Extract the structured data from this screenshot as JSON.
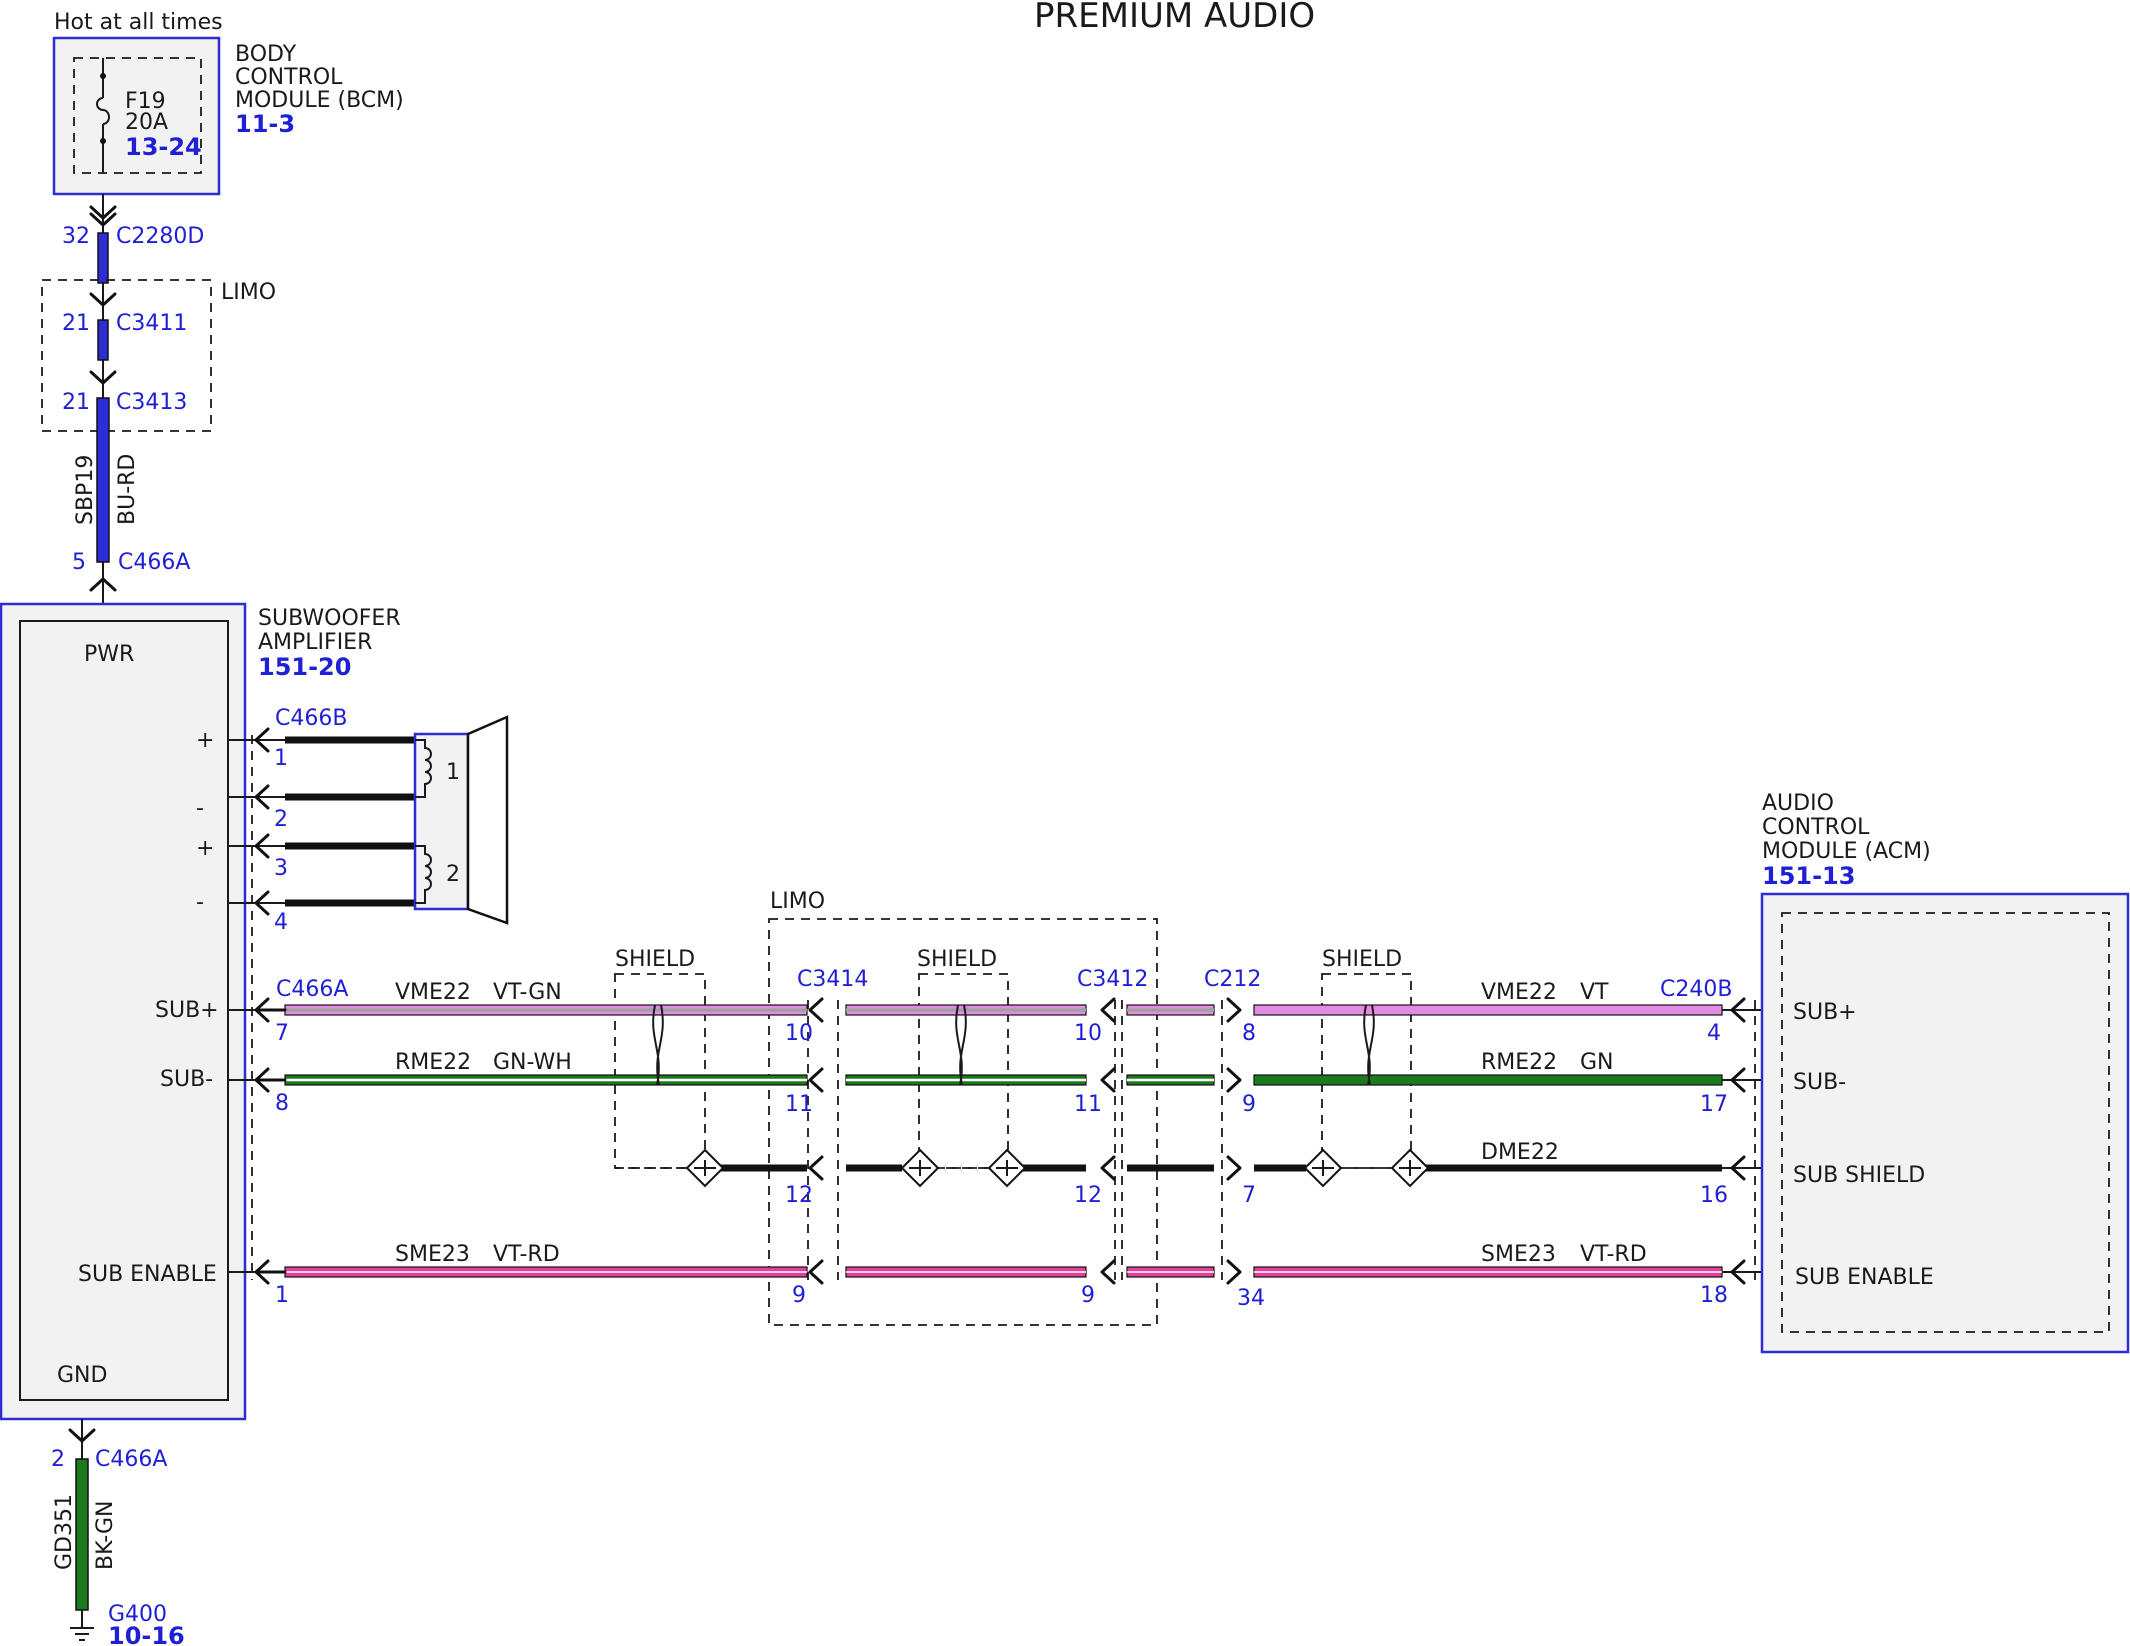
{
  "title": "PREMIUM AUDIO",
  "power_source": "Hot at all times",
  "bcm": {
    "name_lines": [
      "BODY",
      "CONTROL",
      "MODULE (BCM)"
    ],
    "ref": "11-3",
    "fuse": {
      "id": "F19",
      "rating": "20A",
      "ref": "13-24"
    }
  },
  "connectors": {
    "c2280d": {
      "name": "C2280D",
      "pin": "32"
    },
    "c3411": {
      "name": "C3411",
      "pin": "21"
    },
    "c3413": {
      "name": "C3413",
      "pin": "21"
    },
    "c466a_pwr": {
      "name": "C466A",
      "pin": "5"
    },
    "c466b": {
      "name": "C466B",
      "pins": [
        "1",
        "2",
        "3",
        "4"
      ]
    },
    "c466a_sig": {
      "name": "C466A",
      "pins": [
        "7",
        "8",
        "1"
      ]
    },
    "c3414": {
      "name": "C3414",
      "pins": [
        "10",
        "11",
        "12",
        "9"
      ]
    },
    "c3412": {
      "name": "C3412",
      "pins": [
        "10",
        "11",
        "12",
        "9"
      ]
    },
    "c212": {
      "name": "C212",
      "pins": [
        "8",
        "9",
        "7",
        "34"
      ]
    },
    "c240b": {
      "name": "C240B",
      "pins": [
        "4",
        "17",
        "16",
        "18"
      ]
    },
    "c466a_gnd": {
      "name": "C466A",
      "pin": "2"
    }
  },
  "limo_label": "LIMO",
  "shield_label": "SHIELD",
  "power_wire": {
    "circuit": "SBP19",
    "color": "BU-RD"
  },
  "ground_wire": {
    "circuit": "GD351",
    "color": "BK-GN"
  },
  "ground": {
    "name": "G400",
    "ref": "10-16"
  },
  "subwoofer_amp": {
    "name_lines": [
      "SUBWOOFER",
      "AMPLIFIER"
    ],
    "ref": "151-20",
    "pins": {
      "pwr": "PWR",
      "gnd": "GND",
      "sub_plus": "SUB+",
      "sub_minus": "SUB-",
      "sub_enable": "SUB ENABLE",
      "spk": [
        "+",
        "-",
        "+",
        "-"
      ]
    }
  },
  "speaker_coils": [
    "1",
    "2"
  ],
  "acm": {
    "name_lines": [
      "AUDIO",
      "CONTROL",
      "MODULE (ACM)"
    ],
    "ref": "151-13",
    "pins": {
      "sub_plus": "SUB+",
      "sub_minus": "SUB-",
      "sub_shield": "SUB SHIELD",
      "sub_enable": "SUB ENABLE"
    }
  },
  "wires": {
    "sub_plus_left": {
      "circuit": "VME22",
      "color": "VT-GN"
    },
    "sub_minus_left": {
      "circuit": "RME22",
      "color": "GN-WH"
    },
    "sub_enable_left": {
      "circuit": "SME23",
      "color": "VT-RD"
    },
    "sub_plus_right": {
      "circuit": "VME22",
      "color": "VT"
    },
    "sub_minus_right": {
      "circuit": "RME22",
      "color": "GN"
    },
    "shield_right": {
      "circuit": "DME22"
    },
    "sub_enable_right": {
      "circuit": "SME23",
      "color": "VT-RD"
    }
  },
  "colors": {
    "module_outline": "#2d2dd6",
    "label_blue": "#1f1fd6",
    "violet": "#e48be4",
    "violet_green_stripe": "#9aa29a",
    "green": "#1b7a1b",
    "green_white_stripe": "#ffffff",
    "violet_red": "#e0409a",
    "blue_red": "#2d2dd6"
  }
}
